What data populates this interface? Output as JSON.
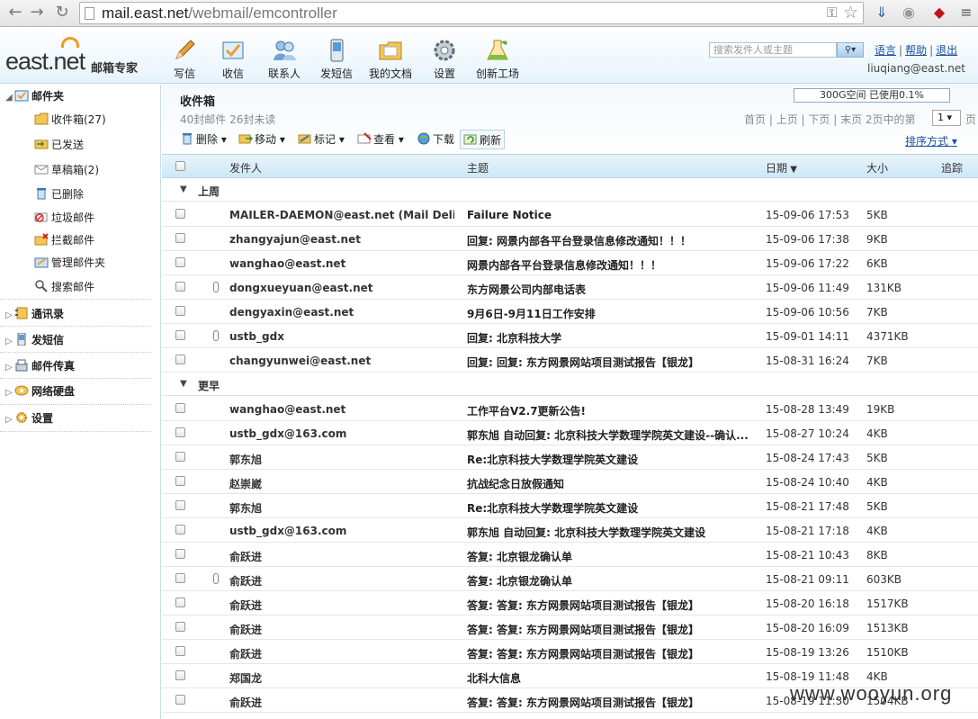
{
  "browser": {
    "url_host": "mail.east.net",
    "url_path": "/webmail/emcontroller"
  },
  "header": {
    "logo_text": "east.net",
    "logo_sub": "邮箱专家",
    "toolbar": [
      {
        "label": "写信",
        "icon": "pencil-icon"
      },
      {
        "label": "收信",
        "icon": "inbox-tray-icon"
      },
      {
        "label": "联系人",
        "icon": "contacts-icon"
      },
      {
        "label": "发短信",
        "icon": "mobile-phone-icon"
      },
      {
        "label": "我的文档",
        "icon": "documents-folder-icon"
      },
      {
        "label": "设置",
        "icon": "gear-icon"
      },
      {
        "label": "创新工场",
        "icon": "flask-icon"
      }
    ],
    "search_placeholder": "搜索发件人或主题",
    "links": {
      "language": "语言",
      "help": "帮助",
      "logout": "退出"
    },
    "user_email": "liuqiang@east.net"
  },
  "sidebar": {
    "mailbox_label": "邮件夹",
    "folders": [
      {
        "label": "收件箱(27)",
        "icon": "inbox-folder-icon"
      },
      {
        "label": "已发送",
        "icon": "sent-icon"
      },
      {
        "label": "草稿箱(2)",
        "icon": "draft-envelope-icon"
      },
      {
        "label": "已删除",
        "icon": "trash-icon"
      },
      {
        "label": "垃圾邮件",
        "icon": "spam-icon"
      },
      {
        "label": "拦截邮件",
        "icon": "blocked-mail-icon"
      },
      {
        "label": "管理邮件夹",
        "icon": "manage-folder-icon"
      },
      {
        "label": "搜索邮件",
        "icon": "magnifier-icon"
      }
    ],
    "groups": [
      {
        "label": "通讯录",
        "icon": "address-book-icon"
      },
      {
        "label": "发短信",
        "icon": "sms-icon"
      },
      {
        "label": "邮件传真",
        "icon": "fax-icon"
      },
      {
        "label": "网络硬盘",
        "icon": "network-disk-icon"
      },
      {
        "label": "设置",
        "icon": "settings-icon"
      }
    ]
  },
  "main": {
    "folder_title": "收件箱",
    "folder_stats": "40封邮件 26封未读",
    "quota": "300G空间 已使用0.1%",
    "pager": {
      "first": "首页",
      "prev": "上页",
      "next": "下页",
      "last": "末页",
      "info": "2页中的第",
      "current": "1 ▾",
      "unit": "页"
    },
    "actions": {
      "delete": "删除",
      "move": "移动",
      "mark": "标记",
      "view": "查看",
      "download": "下载",
      "refresh": "刷新"
    },
    "sort_label": "排序方式",
    "columns": {
      "from": "发件人",
      "subject": "主题",
      "date": "日期",
      "size": "大小",
      "track": "追踪"
    },
    "groups": [
      {
        "label": "上周",
        "rows": [
          {
            "from": "MAILER-DAEMON@east.net (Mail Delive...",
            "subject": "Failure Notice",
            "date": "15-09-06 17:53",
            "size": "5KB",
            "attach": false,
            "unread": true
          },
          {
            "from": "zhangyajun@east.net",
            "subject": "回复: 网景内部各平台登录信息修改通知！！！",
            "date": "15-09-06 17:38",
            "size": "9KB",
            "attach": false,
            "unread": true
          },
          {
            "from": "wanghao@east.net",
            "subject": "网景内部各平台登录信息修改通知！！！",
            "date": "15-09-06 17:22",
            "size": "6KB",
            "attach": false,
            "unread": true
          },
          {
            "from": "dongxueyuan@east.net",
            "subject": "东方网景公司内部电话表",
            "date": "15-09-06 11:49",
            "size": "131KB",
            "attach": true,
            "unread": true
          },
          {
            "from": "dengyaxin@east.net",
            "subject": "9月6日-9月11日工作安排",
            "date": "15-09-06 10:56",
            "size": "7KB",
            "attach": false,
            "unread": true
          },
          {
            "from": "ustb_gdx",
            "subject": "回复: 北京科技大学",
            "date": "15-09-01 14:11",
            "size": "4371KB",
            "attach": true,
            "unread": true
          },
          {
            "from": "changyunwei@east.net",
            "subject": "回复: 回复: 东方网景网站项目测试报告【银龙】",
            "date": "15-08-31 16:24",
            "size": "7KB",
            "attach": false,
            "unread": true
          }
        ]
      },
      {
        "label": "更早",
        "rows": [
          {
            "from": "wanghao@east.net",
            "subject": "工作平台V2.7更新公告!",
            "date": "15-08-28 13:49",
            "size": "19KB",
            "attach": false,
            "unread": true
          },
          {
            "from": "ustb_gdx@163.com",
            "subject": "郭东旭 自动回复: 北京科技大学数理学院英文建设--确认...",
            "date": "15-08-27 10:24",
            "size": "4KB",
            "attach": false,
            "unread": true
          },
          {
            "from": "郭东旭",
            "subject": "Re:北京科技大学数理学院英文建设",
            "date": "15-08-24 17:43",
            "size": "5KB",
            "attach": false,
            "unread": true
          },
          {
            "from": "赵崇崴",
            "subject": "抗战纪念日放假通知",
            "date": "15-08-24 10:40",
            "size": "4KB",
            "attach": false,
            "unread": true
          },
          {
            "from": "郭东旭",
            "subject": "Re:北京科技大学数理学院英文建设",
            "date": "15-08-21 17:48",
            "size": "5KB",
            "attach": false,
            "unread": true
          },
          {
            "from": "ustb_gdx@163.com",
            "subject": "郭东旭 自动回复: 北京科技大学数理学院英文建设",
            "date": "15-08-21 17:18",
            "size": "4KB",
            "attach": false,
            "unread": true
          },
          {
            "from": "俞跃进",
            "subject": "答复: 北京银龙确认单",
            "date": "15-08-21 10:43",
            "size": "8KB",
            "attach": false,
            "unread": true
          },
          {
            "from": "俞跃进",
            "subject": "答复: 北京银龙确认单",
            "date": "15-08-21 09:11",
            "size": "603KB",
            "attach": true,
            "unread": true
          },
          {
            "from": "俞跃进",
            "subject": "答复: 答复: 东方网景网站项目测试报告【银龙】",
            "date": "15-08-20 16:18",
            "size": "1517KB",
            "attach": false,
            "unread": true
          },
          {
            "from": "俞跃进",
            "subject": "答复: 答复: 东方网景网站项目测试报告【银龙】",
            "date": "15-08-20 16:09",
            "size": "1513KB",
            "attach": false,
            "unread": true
          },
          {
            "from": "俞跃进",
            "subject": "答复: 答复: 东方网景网站项目测试报告【银龙】",
            "date": "15-08-19 13:26",
            "size": "1510KB",
            "attach": false,
            "unread": true
          },
          {
            "from": "郑国龙",
            "subject": "北科大信息",
            "date": "15-08-19 11:48",
            "size": "4KB",
            "attach": false,
            "unread": true
          },
          {
            "from": "俞跃进",
            "subject": "答复: 答复: 东方网景网站项目测试报告【银龙】",
            "date": "15-08-19 11:30",
            "size": "1504KB",
            "attach": false,
            "unread": true
          }
        ]
      }
    ]
  },
  "watermark": "www.wooyun.org",
  "colors": {
    "accent": "#1a4f9c",
    "header_bg": "#e6f3fb",
    "table_header": "#cfe7f6"
  }
}
